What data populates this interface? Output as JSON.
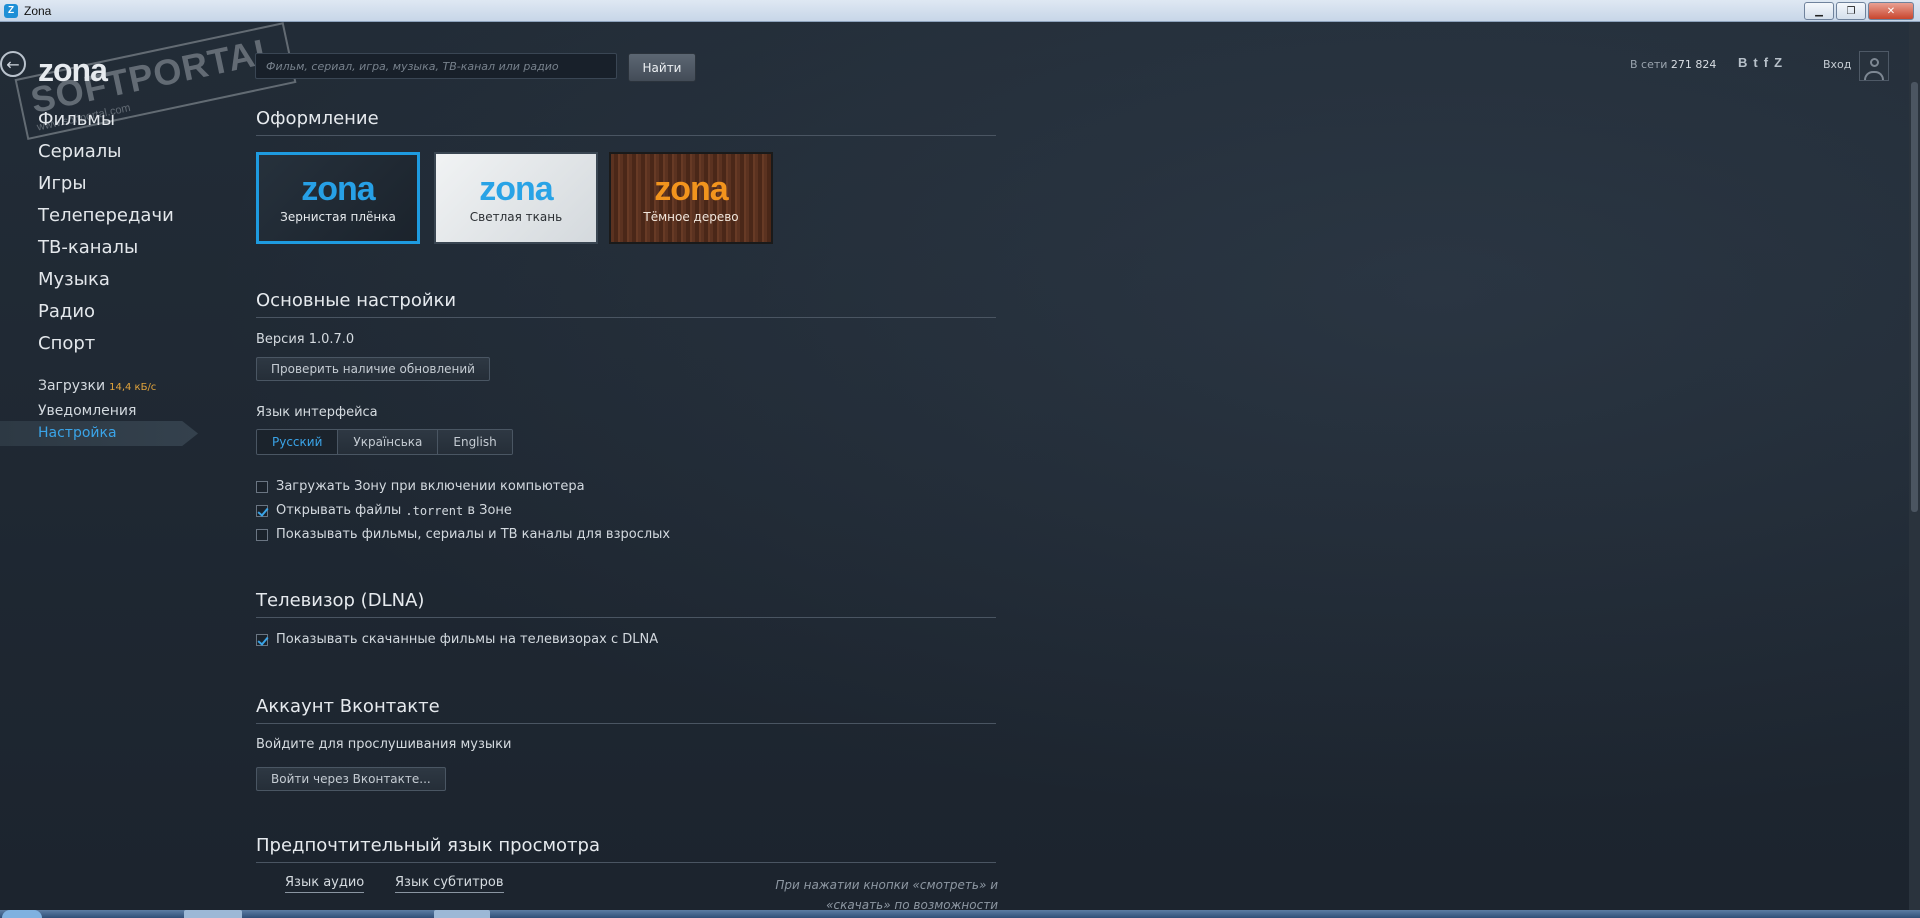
{
  "window": {
    "title": "Zona",
    "icon": "zona-app-icon",
    "min": "▁",
    "max": "❐",
    "close": "✕"
  },
  "header": {
    "back_icon": "arrow-left-icon",
    "logo": "zona",
    "watermark": "SOFTPORTAL",
    "watermark_url": "www.softportal.com",
    "search_placeholder": "Фильм, сериал, игра, музыка, ТВ-канал или радио",
    "search_button": "Найти",
    "online_label": "В сети",
    "online_count": "271 824",
    "socials": [
      "B",
      "t",
      "f",
      "Z"
    ],
    "login": "Вход"
  },
  "sidebar": {
    "main": [
      "Фильмы",
      "Сериалы",
      "Игры",
      "Телепередачи",
      "ТВ-каналы",
      "Музыка",
      "Радио",
      "Спорт"
    ],
    "downloads": "Загрузки",
    "downloads_speed": "14,4 кБ/с",
    "notifications": "Уведомления",
    "settings": "Настройка"
  },
  "settings": {
    "appearance": {
      "title": "Оформление",
      "themes": [
        {
          "logo": "zona",
          "name": "Зернистая плёнка",
          "selected": true
        },
        {
          "logo": "zona",
          "name": "Светлая ткань",
          "selected": false
        },
        {
          "logo": "zona",
          "name": "Тёмное дерево",
          "selected": false
        }
      ]
    },
    "general": {
      "title": "Основные настройки",
      "version": "Версия 1.0.7.0",
      "check_updates": "Проверить наличие обновлений",
      "language_label": "Язык интерфейса",
      "languages": [
        "Русский",
        "Українська",
        "English"
      ],
      "selected_language": "Русский",
      "options": [
        {
          "pre": "Загружать Зону при включении компьютера",
          "mono": "",
          "post": "",
          "checked": false
        },
        {
          "pre": "Открывать файлы ",
          "mono": ".torrent",
          "post": " в Зоне",
          "checked": true
        },
        {
          "pre": "Показывать фильмы, сериалы и ТВ каналы для взрослых",
          "mono": "",
          "post": "",
          "checked": false
        }
      ]
    },
    "dlna": {
      "title": "Телевизор (DLNA)",
      "option": "Показывать скачанные фильмы на телевизорах с DLNA",
      "checked": true
    },
    "vk": {
      "title": "Аккаунт Вконтакте",
      "description": "Войдите для прослушивания музыки",
      "login_button": "Войти через Вконтакте..."
    },
    "preferred": {
      "title": "Предпочтительный язык просмотра",
      "audio_tab": "Язык аудио",
      "subtitles_tab": "Язык субтитров",
      "hint": "При нажатии кнопки «смотреть» и «скачать» по возможности"
    }
  },
  "colors": {
    "accent": "#1e9be0",
    "speed": "#e1a33b",
    "background": "#1f2833"
  }
}
